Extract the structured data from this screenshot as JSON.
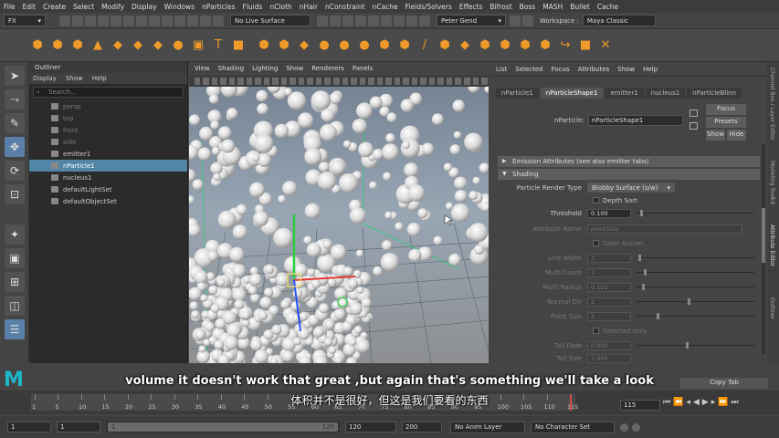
{
  "menubar": {
    "items": [
      "File",
      "Edit",
      "Create",
      "Select",
      "Modify",
      "Display",
      "Windows",
      "nParticles",
      "Fluids",
      "nCloth",
      "nHair",
      "nConstraint",
      "nCache",
      "Fields/Solvers",
      "Effects",
      "Bifrost",
      "Boss",
      "MASH",
      "Bullet",
      "Cache"
    ],
    "workspace_label": "Workspace :",
    "workspace_value": "Maya Classic"
  },
  "statusline": {
    "menuset": "FX",
    "live_surface": "No Live Surface",
    "user": "Peter Gend"
  },
  "outliner": {
    "title": "Outliner",
    "menu": [
      "Display",
      "Show",
      "Help"
    ],
    "search_placeholder": "Search...",
    "items": [
      {
        "label": "persp",
        "dim": true
      },
      {
        "label": "top",
        "dim": true
      },
      {
        "label": "front",
        "dim": true
      },
      {
        "label": "side",
        "dim": true
      },
      {
        "label": "emitter1",
        "dim": false
      },
      {
        "label": "nParticle1",
        "dim": false,
        "selected": true
      },
      {
        "label": "nucleus1",
        "dim": false
      },
      {
        "label": "defaultLightSet",
        "dim": false
      },
      {
        "label": "defaultObjectSet",
        "dim": false
      }
    ]
  },
  "viewport": {
    "menu": [
      "View",
      "Shading",
      "Lighting",
      "Show",
      "Renderers",
      "Panels"
    ]
  },
  "attribute_editor": {
    "menu": [
      "List",
      "Selected",
      "Focus",
      "Attributes",
      "Show",
      "Help"
    ],
    "tabs": [
      "nParticle1",
      "nParticleShape1",
      "emitter1",
      "nucleus1",
      "nParticleBlinn"
    ],
    "active_tab": "nParticleShape1",
    "node_label": "nParticle:",
    "node_value": "nParticleShape1",
    "buttons": {
      "focus": "Focus",
      "presets": "Presets",
      "show": "Show",
      "hide": "Hide"
    },
    "section_emission": "Emission Attributes (see also emitter tabs)",
    "section_shading": "Shading",
    "render_type_label": "Particle Render Type",
    "render_type_value": "Blobby Surface (s/w)",
    "depth_sort": "Depth Sort",
    "threshold_label": "Threshold",
    "threshold_value": "0.100",
    "attribute_name_label": "Attribute Name",
    "attribute_name_value": "pointSize",
    "color_accum": "Color Accum",
    "line_width_label": "Line Width",
    "line_width_value": "1",
    "multi_count_label": "Multi Count",
    "multi_count_value": "7",
    "multi_radius_label": "Multi Radius",
    "multi_radius_value": "0.122",
    "normal_dir_label": "Normal Dir",
    "normal_dir_value": "2",
    "point_size_label": "Point Size",
    "point_size_value": "2",
    "selected_only": "Selected Only",
    "tail_fade_label": "Tail Fade",
    "tail_fade_value": "0.000",
    "tail_size_label": "Tail Size",
    "tail_size_value": "1.000",
    "copy_tab": "Copy Tab"
  },
  "side_tabs": [
    "Channel Box / Layer Editor",
    "Modeling Toolkit",
    "Attribute Editor",
    "Outliner"
  ],
  "timeline": {
    "ticks": [
      "1",
      "5",
      "10",
      "15",
      "20",
      "25",
      "30",
      "35",
      "40",
      "45",
      "50",
      "55",
      "60",
      "65",
      "70",
      "75",
      "80",
      "85",
      "90",
      "95",
      "100",
      "105",
      "110",
      "115"
    ],
    "current_frame": "115",
    "range_start": "1",
    "range_inner_start": "1",
    "range_handle": "1",
    "range_inner_end": "120",
    "range_end": "120",
    "anim_end": "200",
    "anim_layer": "No Anim Layer",
    "character_set": "No Character Set"
  },
  "subtitles": {
    "english": "volume it doesn't work that great ,but again that's something we'll take a look",
    "chinese": "体积并不是很好，但这是我们要看的东西"
  },
  "colors": {
    "accent_blue": "#5285a6",
    "shelf_orange": "#f09a2a",
    "logo_teal": "#1bb8c8"
  }
}
